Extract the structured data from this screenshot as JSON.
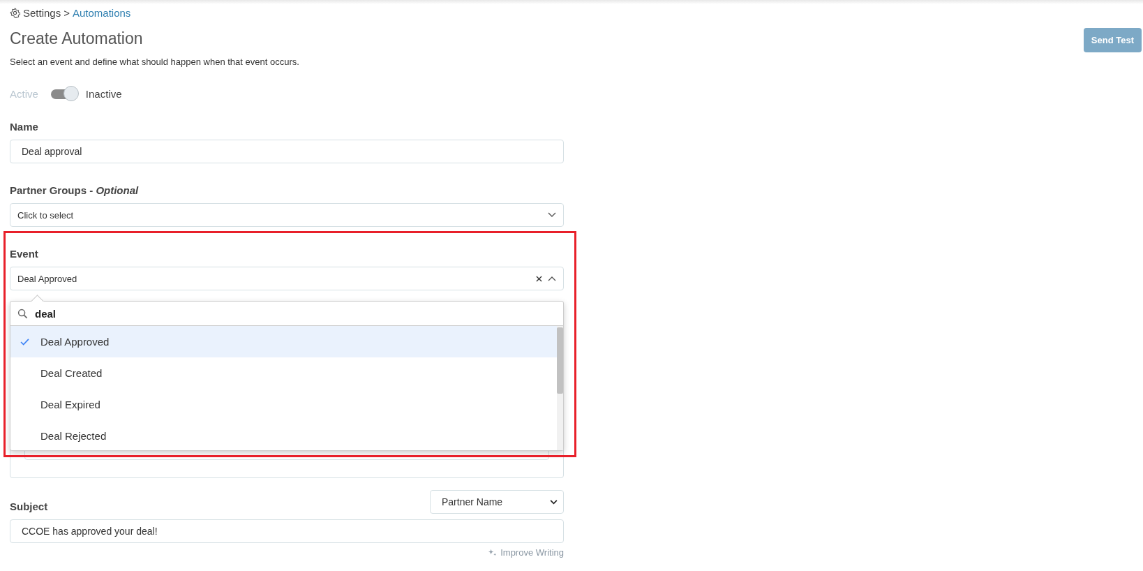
{
  "breadcrumb": {
    "root": "Settings",
    "separator": ">",
    "current": "Automations"
  },
  "title": "Create Automation",
  "description": "Select an event and define what should happen when that event occurs.",
  "send_test": {
    "label": "Send Test",
    "disabled": true
  },
  "status_toggle": {
    "on_label": "Active",
    "off_label": "Inactive",
    "on": false
  },
  "name": {
    "label": "Name",
    "value": "Deal approval"
  },
  "partner_groups": {
    "label": "Partner Groups",
    "hint_separator": "-",
    "hint": "Optional",
    "placeholder": "Click to select"
  },
  "event": {
    "label": "Event",
    "value": "Deal Approved",
    "expanded": true,
    "dropdown": {
      "search": "deal",
      "options": [
        {
          "label": "Deal Approved",
          "selected": true
        },
        {
          "label": "Deal Created",
          "selected": false
        },
        {
          "label": "Deal Expired",
          "selected": false
        },
        {
          "label": "Deal Rejected",
          "selected": false
        }
      ]
    }
  },
  "subject": {
    "label": "Subject",
    "token": "Partner Name",
    "value": "CCOE has approved your deal!",
    "improve": "Improve Writing"
  }
}
